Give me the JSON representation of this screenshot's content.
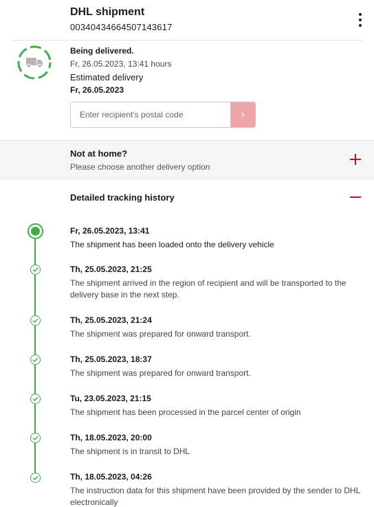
{
  "header": {
    "title": "DHL shipment",
    "tracking_number": "00340434664507143617"
  },
  "status": {
    "headline": "Being delivered.",
    "timestamp": "Fr, 26.05.2023, 13:41 hours",
    "estimate_label": "Estimated delivery",
    "estimate_date": "Fr, 26.05.2023",
    "icon": "truck-icon",
    "ring_color": "#3fae49"
  },
  "postal_code": {
    "placeholder": "Enter recipient's postal code",
    "value": "",
    "submit_glyph": "›"
  },
  "not_at_home": {
    "title": "Not at home?",
    "subtitle": "Please choose another delivery option",
    "toggle": "+"
  },
  "history": {
    "title": "Detailed tracking history",
    "toggle": "−",
    "events": [
      {
        "date": "Fr, 26.05.2023, 13:41",
        "text": "The shipment has been loaded onto the delivery vehicle"
      },
      {
        "date": "Th, 25.05.2023, 21:25",
        "text": "The shipment arrived in the region of recipient and will be transported to the delivery base in the next step."
      },
      {
        "date": "Th, 25.05.2023, 21:24",
        "text": "The shipment was prepared for onward transport."
      },
      {
        "date": "Th, 25.05.2023, 18:37",
        "text": "The shipment was prepared for onward transport."
      },
      {
        "date": "Tu, 23.05.2023, 21:15",
        "text": "The shipment has been processed in the parcel center of origin"
      },
      {
        "date": "Th, 18.05.2023, 20:00",
        "text": "The shipment is in transit to DHL"
      },
      {
        "date": "Th, 18.05.2023, 04:26",
        "text": "The instruction data for this shipment have been provided by the sender to DHL electronically"
      }
    ]
  },
  "colors": {
    "accent_red": "#d40511",
    "accent_green": "#3fae49",
    "submit_button": "#f0a6a9"
  }
}
